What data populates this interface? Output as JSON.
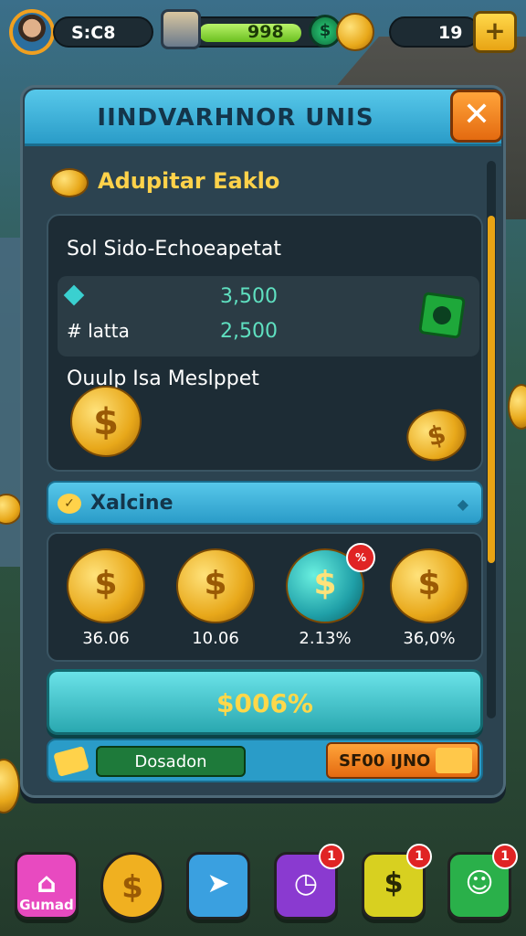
{
  "topbar": {
    "currency_value": "S:C8",
    "xp_value": "998",
    "right_value": "19",
    "xp_fill_fraction": 0.8
  },
  "panel": {
    "title": "IINDVARHNOR UNIS",
    "close_glyph": "✕",
    "section_heading": "Adupitar Eaklo",
    "card": {
      "title": "Sol Sido-Echoeapetat",
      "rows": [
        {
          "label": "",
          "value": "3,500",
          "icon": "diamond-icon"
        },
        {
          "label": "# latta",
          "value": "2,500"
        }
      ],
      "subtitle": "Ouulp Isa Meslppet"
    },
    "tab": {
      "label": "Xalcine",
      "arrow": "◆"
    },
    "packs": [
      {
        "price": "36.06",
        "icon": "coin-stack-icon"
      },
      {
        "price": "10.06",
        "icon": "coin-stack-icon"
      },
      {
        "price": "2.13%",
        "icon": "gem-coin-stack-icon",
        "badge": "%"
      },
      {
        "price": "36,0%",
        "icon": "coin-stack-icon"
      }
    ],
    "buy_label": "$006%",
    "donation_label": "Dosadon",
    "price_button_label": "SF00 IJNO"
  },
  "dock": [
    {
      "id": "home",
      "label": "Gumad",
      "color": "#e84ac0",
      "icon": "home-icon",
      "glyph": "⌂",
      "notif": ""
    },
    {
      "id": "coin",
      "label": "",
      "color": "#f0b020",
      "icon": "coin-icon",
      "glyph": "$",
      "notif": ""
    },
    {
      "id": "map",
      "label": "",
      "color": "#3aa0e0",
      "icon": "map-icon",
      "glyph": "➤",
      "notif": ""
    },
    {
      "id": "clock",
      "label": "",
      "color": "#8a3ad0",
      "icon": "clock-icon",
      "glyph": "◷",
      "notif": "1"
    },
    {
      "id": "cash",
      "label": "",
      "color": "#d8d020",
      "icon": "dollar-icon",
      "glyph": "$",
      "notif": "1"
    },
    {
      "id": "friends",
      "label": "",
      "color": "#2ab04a",
      "icon": "friends-icon",
      "glyph": "☺",
      "notif": "1"
    }
  ]
}
